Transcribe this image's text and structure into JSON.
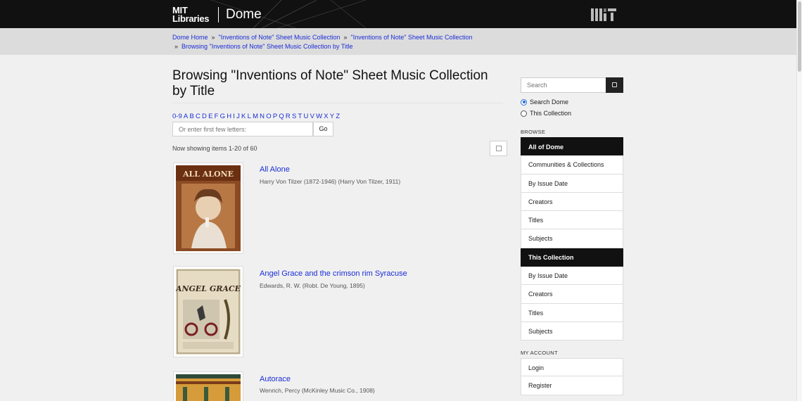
{
  "header": {
    "logo_line1": "MIT",
    "logo_line2": "Libraries",
    "app_name": "Dome",
    "mit_mark": "MIT"
  },
  "breadcrumb": [
    {
      "label": "Dome Home"
    },
    {
      "label": "\"Inventions of Note\" Sheet Music Collection"
    },
    {
      "label": "\"Inventions of Note\" Sheet Music Collection"
    },
    {
      "label": "Browsing \"Inventions of Note\" Sheet Music Collection by Title"
    }
  ],
  "breadcrumb_separator": "»",
  "main": {
    "title": "Browsing \"Inventions of Note\" Sheet Music Collection by Title",
    "alpha_links": [
      "0-9",
      "A",
      "B",
      "C",
      "D",
      "E",
      "F",
      "G",
      "H",
      "I",
      "J",
      "K",
      "L",
      "M",
      "N",
      "O",
      "P",
      "Q",
      "R",
      "S",
      "T",
      "U",
      "V",
      "W",
      "X",
      "Y",
      "Z"
    ],
    "starts_with_placeholder": "Or enter first few letters:",
    "go_label": "Go",
    "showing_text": "Now showing items 1-20 of 60",
    "options_icon": "options-icon"
  },
  "items": [
    {
      "title": "All Alone",
      "meta": "Harry Von Tilzer (1872-1946) (Harry Von Tilzer, 1911)",
      "thumb_text": "ALL ALONE"
    },
    {
      "title": "Angel Grace and the crimson rim Syracuse",
      "meta": "Edwards, R. W. (Robt. De Young, 1895)",
      "thumb_text": "ANGEL GRACE"
    },
    {
      "title": "Autorace",
      "meta": "Wenrich, Percy (McKinley Music Co., 1908)",
      "thumb_text": ""
    }
  ],
  "sidebar": {
    "search_placeholder": "Search",
    "search_icon": "search-icon",
    "scope_options": [
      {
        "label": "Search Dome",
        "selected": true
      },
      {
        "label": "This Collection",
        "selected": false
      }
    ],
    "browse_heading": "BROWSE",
    "all_of_dome_label": "All of Dome",
    "all_of_dome_items": [
      "Communities & Collections",
      "By Issue Date",
      "Creators",
      "Titles",
      "Subjects"
    ],
    "this_collection_label": "This Collection",
    "this_collection_items": [
      "By Issue Date",
      "Creators",
      "Titles",
      "Subjects"
    ],
    "account_heading": "MY ACCOUNT",
    "account_items": [
      "Login",
      "Register"
    ]
  },
  "colors": {
    "link": "#1a2dd6",
    "header_bg": "#111111",
    "crumb_bg": "#dcdcdc",
    "page_bg": "#f0f0f0"
  }
}
